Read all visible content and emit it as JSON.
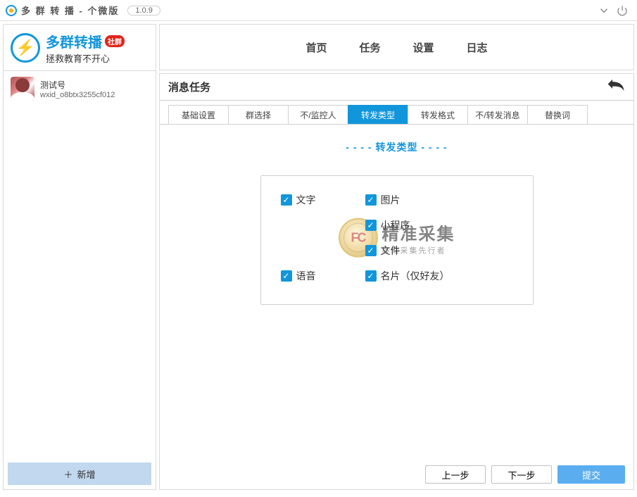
{
  "titlebar": {
    "title": "多 群 转 播 - 个微版",
    "version": "1.0.9"
  },
  "brand": {
    "name": "多群转播",
    "badge": "社群",
    "slogan": "拯救教育不开心"
  },
  "account": {
    "name": "测试号",
    "id": "wxid_o8btx3255cf012"
  },
  "sidebar": {
    "add_label": "新增"
  },
  "nav": {
    "items": [
      "首页",
      "任务",
      "设置",
      "日志"
    ]
  },
  "panel": {
    "title": "消息任务",
    "tabs": [
      "基础设置",
      "群选择",
      "不/监控人",
      "转发类型",
      "转发格式",
      "不/转发消息",
      "替换词"
    ],
    "active_tab_index": 3,
    "section_title": "- - - - 转发类型 - - - -",
    "options": {
      "text": "文字",
      "image": "图片",
      "miniapp": "小程序",
      "file": "文件",
      "voice": "语音",
      "card": "名片（仅好友）"
    },
    "watermark": {
      "circle": "FC",
      "line1": "精准采集",
      "line2": "移动采集先行者"
    },
    "buttons": {
      "prev": "上一步",
      "next": "下一步",
      "submit": "提交"
    }
  }
}
